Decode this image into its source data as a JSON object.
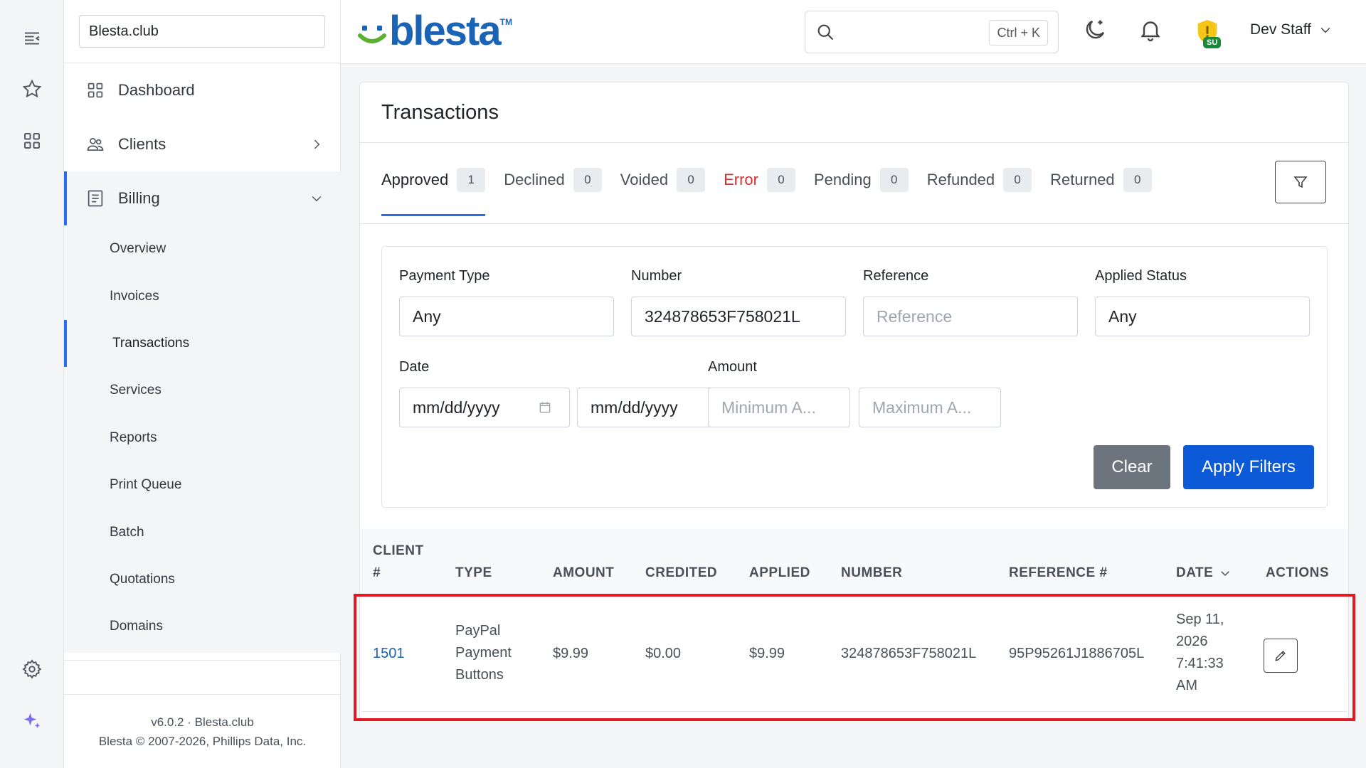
{
  "company": "Blesta.club",
  "logo": {
    "text": "blesta",
    "tm": "TM"
  },
  "search": {
    "placeholder": "",
    "shortcut": "Ctrl + K"
  },
  "user": {
    "name": "Dev Staff",
    "badge": "SU"
  },
  "nav": {
    "dashboard": "Dashboard",
    "clients": "Clients",
    "billing": "Billing",
    "billing_items": [
      "Overview",
      "Invoices",
      "Transactions",
      "Services",
      "Reports",
      "Print Queue",
      "Batch",
      "Quotations",
      "Domains"
    ]
  },
  "footer": {
    "line1": "v6.0.2 · Blesta.club",
    "line2": "Blesta © 2007-2026, Phillips Data, Inc."
  },
  "page_title": "Transactions",
  "tabs": [
    {
      "label": "Approved",
      "count": "1"
    },
    {
      "label": "Declined",
      "count": "0"
    },
    {
      "label": "Voided",
      "count": "0"
    },
    {
      "label": "Error",
      "count": "0"
    },
    {
      "label": "Pending",
      "count": "0"
    },
    {
      "label": "Refunded",
      "count": "0"
    },
    {
      "label": "Returned",
      "count": "0"
    }
  ],
  "filters": {
    "payment_type": {
      "label": "Payment Type",
      "value": "Any"
    },
    "number": {
      "label": "Number",
      "value": "324878653F758021L"
    },
    "reference": {
      "label": "Reference",
      "placeholder": "Reference"
    },
    "applied_status": {
      "label": "Applied Status",
      "value": "Any"
    },
    "date": {
      "label": "Date",
      "start": "mm/dd/yyyy",
      "end": "mm/dd/yyyy"
    },
    "amount": {
      "label": "Amount",
      "min_placeholder": "Minimum A...",
      "max_placeholder": "Maximum A..."
    },
    "clear": "Clear",
    "apply": "Apply Filters"
  },
  "table": {
    "headers": {
      "client_line1": "CLIENT",
      "client_line2": "#",
      "type": "TYPE",
      "amount": "AMOUNT",
      "credited": "CREDITED",
      "applied": "APPLIED",
      "number": "NUMBER",
      "reference": "REFERENCE #",
      "date": "DATE",
      "actions": "ACTIONS"
    },
    "rows": [
      {
        "client": "1501",
        "type_lines": [
          "PayPal",
          "Payment",
          "Buttons"
        ],
        "amount": "$9.99",
        "credited": "$0.00",
        "applied": "$9.99",
        "number": "324878653F758021L",
        "reference": "95P95261J1886705L",
        "date_lines": [
          "Sep 11,",
          "2026",
          "7:41:33",
          "AM"
        ]
      }
    ]
  },
  "colors": {
    "accent": "#2a6ee6",
    "primary_button": "#0d5ad8",
    "error": "#d63031",
    "highlight": "#e01b24"
  }
}
